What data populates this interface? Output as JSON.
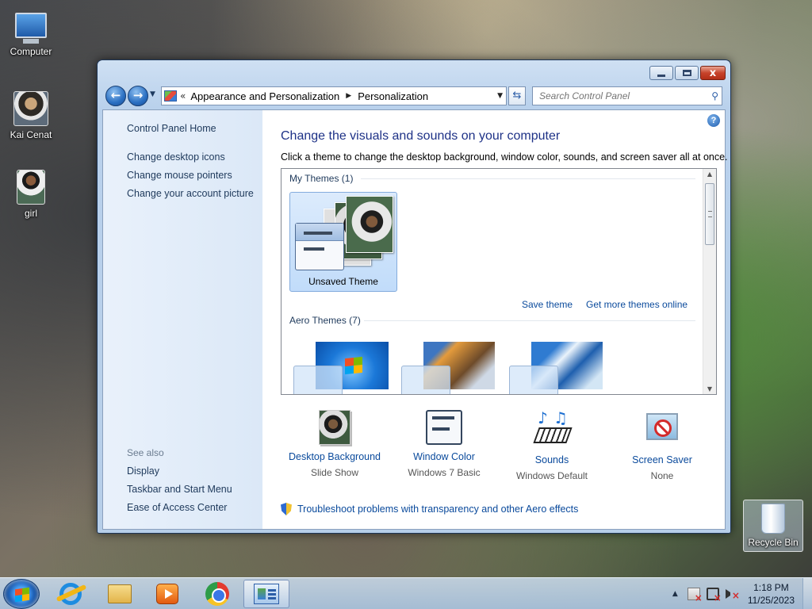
{
  "desktop": {
    "icons": [
      {
        "label": "Computer"
      },
      {
        "label": "Kai Cenat"
      },
      {
        "label": "girl"
      },
      {
        "label": "Recycle Bin"
      }
    ]
  },
  "window": {
    "title_buttons": {
      "minimize": "–",
      "maximize": "□",
      "close": "x"
    },
    "address": {
      "chevron": "«",
      "crumbs": [
        "Appearance and Personalization",
        "Personalization"
      ]
    },
    "search": {
      "placeholder": "Search Control Panel"
    },
    "sidebar": {
      "home": "Control Panel Home",
      "links": [
        "Change desktop icons",
        "Change mouse pointers",
        "Change your account picture"
      ],
      "see_also_title": "See also",
      "see_also": [
        "Display",
        "Taskbar and Start Menu",
        "Ease of Access Center"
      ]
    },
    "main": {
      "help": "?",
      "heading": "Change the visuals and sounds on your computer",
      "subheading": "Click a theme to change the desktop background, window color, sounds, and screen saver all at once.",
      "my_themes": {
        "title": "My Themes (1)",
        "themes": [
          {
            "label": "Unsaved Theme"
          }
        ]
      },
      "links": {
        "save": "Save theme",
        "more": "Get more themes online"
      },
      "aero_themes": {
        "title": "Aero Themes (7)"
      },
      "settings": [
        {
          "title": "Desktop Background",
          "value": "Slide Show",
          "icon": "desktop-background-icon"
        },
        {
          "title": "Window Color",
          "value": "Windows 7 Basic",
          "icon": "window-color-icon"
        },
        {
          "title": "Sounds",
          "value": "Windows Default",
          "icon": "sounds-icon"
        },
        {
          "title": "Screen Saver",
          "value": "None",
          "icon": "screen-saver-icon"
        }
      ],
      "troubleshoot": "Troubleshoot problems with transparency and other Aero effects"
    }
  },
  "taskbar": {
    "apps": [
      "internet-explorer",
      "windows-explorer",
      "windows-media-player",
      "google-chrome",
      "control-panel"
    ],
    "clock": {
      "time": "1:18 PM",
      "date": "11/25/2023"
    }
  }
}
